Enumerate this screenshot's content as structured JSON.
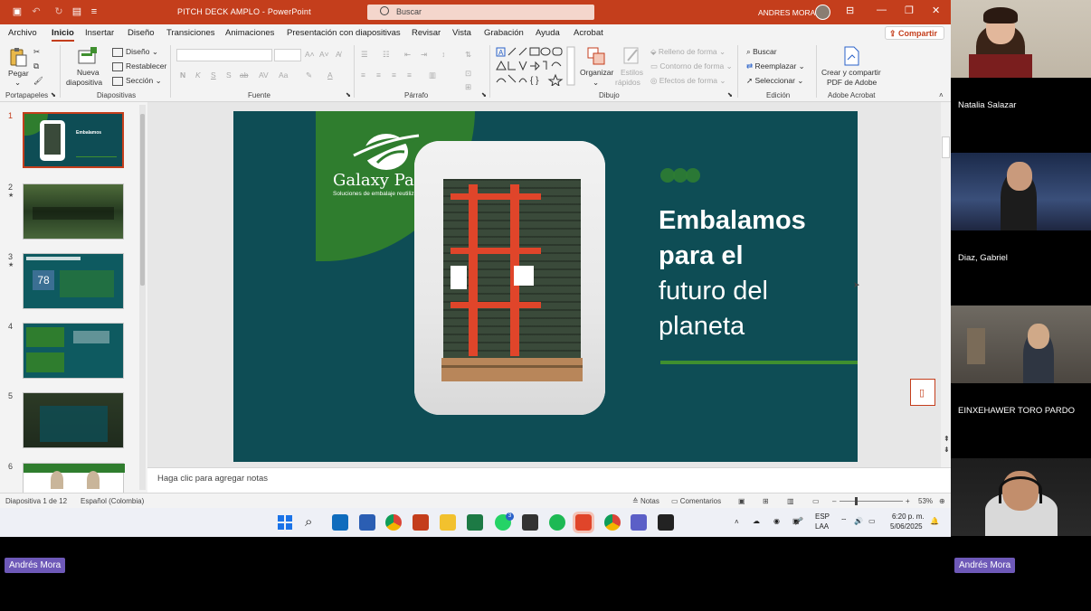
{
  "titlebar": {
    "doc_title": "PITCH DECK AMPLO  -  PowerPoint",
    "search_placeholder": "Buscar",
    "user_name": "ANDRES MORA"
  },
  "menus": [
    "Archivo",
    "Inicio",
    "Insertar",
    "Diseño",
    "Transiciones",
    "Animaciones",
    "Presentación con diapositivas",
    "Revisar",
    "Vista",
    "Grabación",
    "Ayuda",
    "Acrobat"
  ],
  "share_label": "Compartir",
  "ribbon": {
    "portapapeles": {
      "label": "Portapapeles",
      "pegar": "Pegar"
    },
    "diapositivas": {
      "label": "Diapositivas",
      "nueva": "Nueva",
      "diapositiva": "diapositiva",
      "diseno": "Diseño",
      "restablecer": "Restablecer",
      "seccion": "Sección"
    },
    "fuente": {
      "label": "Fuente",
      "buttons": [
        "N",
        "K",
        "S",
        "S",
        "ab",
        "AV",
        "Aa"
      ]
    },
    "parrafo": {
      "label": "Párrafo"
    },
    "dibujo": {
      "label": "Dibujo",
      "organizar": "Organizar",
      "estilos": "Estilos",
      "rapidos": "rápidos",
      "relleno": "Relleno de forma",
      "contorno": "Contorno de forma",
      "efectos": "Efectos de forma"
    },
    "edicion": {
      "label": "Edición",
      "buscar": "Buscar",
      "reemplazar": "Reemplazar",
      "seleccionar": "Seleccionar"
    },
    "adobe": {
      "label": "Adobe Acrobat",
      "line1": "Crear y compartir",
      "line2": "PDF de Adobe"
    }
  },
  "thumbnails": [
    {
      "num": "1",
      "star": ""
    },
    {
      "num": "2",
      "star": "★"
    },
    {
      "num": "3",
      "star": "★"
    },
    {
      "num": "4",
      "star": ""
    },
    {
      "num": "5",
      "star": ""
    },
    {
      "num": "6",
      "star": ""
    }
  ],
  "slide": {
    "logo": "Galaxy Pack",
    "logo_sub": "Soluciones de embalaje reutilizables",
    "line1": "Embalamos",
    "line2": "para el",
    "line3": "futuro del",
    "line4": "planeta"
  },
  "notes_placeholder": "Haga clic para agregar notas",
  "status": {
    "slide_info": "Diapositiva 1 de 12",
    "language": "Español (Colombia)",
    "notas": "Notas",
    "comentarios": "Comentarios",
    "zoom": "53%"
  },
  "taskbar": {
    "lang1": "ESP",
    "lang2": "LAA",
    "time": "6:20 p. m.",
    "date": "5/06/2025",
    "whatsapp_badge": "3"
  },
  "participants": [
    {
      "name": "Natalia Salazar"
    },
    {
      "name": "Diaz, Gabriel"
    },
    {
      "name": "EINXEHAWER TORO PARDO"
    },
    {
      "name": "Andrés Mora"
    }
  ],
  "self_label": "Andrés Mora",
  "colors": {
    "ppt_red": "#c43e1c",
    "slide_teal": "#0e4d55",
    "brand_green": "#2f7d2e",
    "chip_purple": "#6e59b8"
  }
}
